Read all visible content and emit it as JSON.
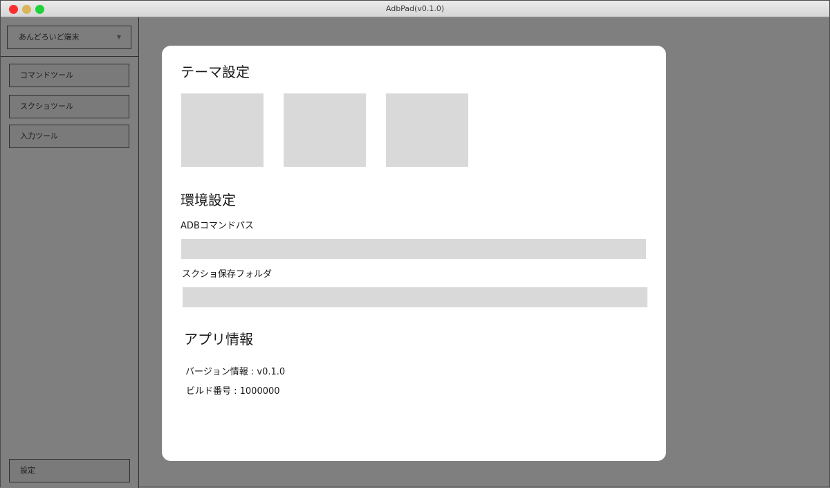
{
  "window": {
    "title": "AdbPad(v0.1.0)"
  },
  "sidebar": {
    "device_select": "あんどろいど端末",
    "items": [
      {
        "label": "コマンドツール"
      },
      {
        "label": "スクショツール"
      },
      {
        "label": "入力ツール"
      }
    ],
    "settings_label": "設定"
  },
  "settings": {
    "theme_heading": "テーマ設定",
    "env_heading": "環境設定",
    "adb_path_label": "ADBコマンドパス",
    "adb_path_value": "",
    "screenshot_folder_label": "スクショ保存フォルダ",
    "screenshot_folder_value": "",
    "app_info_heading": "アプリ情報",
    "version_line": "バージョン情報 : v0.1.0",
    "build_line": "ビルド番号 : 1000000"
  },
  "colors": {
    "background_overlay": "#808080",
    "modal": "#ffffff",
    "swatch_placeholder": "#d9d9d9",
    "traffic_close": "#fe2d2d",
    "traffic_minimize": "#d9b45a",
    "traffic_maximize": "#1fd13b"
  }
}
